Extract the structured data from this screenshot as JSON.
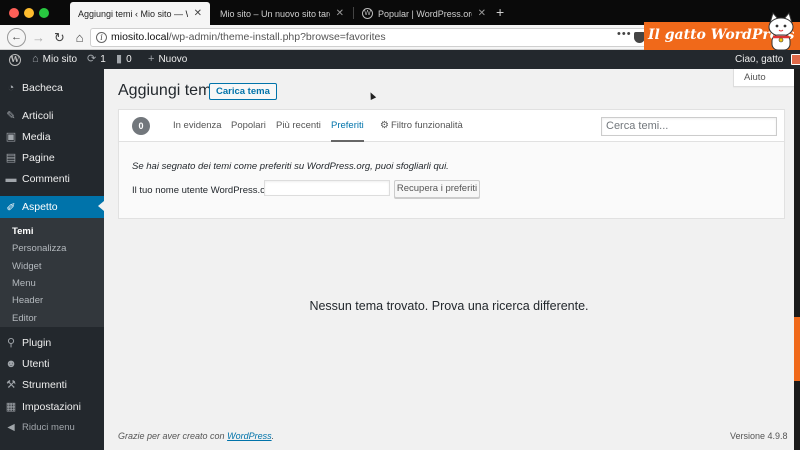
{
  "browser": {
    "tabs": [
      {
        "title": "Aggiungi temi ‹ Mio sito — WordPress",
        "active": true
      },
      {
        "title": "Mio sito – Un nuovo sito targato WordPress",
        "active": false
      },
      {
        "title": "Popular | WordPress.org",
        "active": false
      }
    ],
    "close_glyph": "✕",
    "new_tab_glyph": "+",
    "url_host": "miosito.local",
    "url_path": "/wp-admin/theme-install.php?browse=favorites",
    "overflow_glyph": "•••"
  },
  "brand": {
    "text": "Il gatto WordPress",
    "color": "#f0691a"
  },
  "admin_bar": {
    "site_name": "Mio sito",
    "updates_count": "1",
    "comments_count": "0",
    "new_label": "Nuovo",
    "greeting": "Ciao, gatto"
  },
  "sidebar": {
    "items": [
      {
        "label": "Bacheca",
        "icon": "dashboard-icon"
      },
      {
        "label": "Articoli",
        "icon": "pin-icon"
      },
      {
        "label": "Media",
        "icon": "media-icon"
      },
      {
        "label": "Pagine",
        "icon": "page-icon"
      },
      {
        "label": "Commenti",
        "icon": "comment-icon"
      },
      {
        "label": "Aspetto",
        "icon": "brush-icon",
        "current": true
      }
    ],
    "submenu": [
      "Temi",
      "Personalizza",
      "Widget",
      "Menu",
      "Header",
      "Editor"
    ],
    "items_after": [
      {
        "label": "Plugin",
        "icon": "plugin-icon"
      },
      {
        "label": "Utenti",
        "icon": "users-icon"
      },
      {
        "label": "Strumenti",
        "icon": "wrench-icon"
      },
      {
        "label": "Impostazioni",
        "icon": "settings-icon"
      }
    ],
    "collapse_label": "Riduci menu"
  },
  "main": {
    "help_label": "Aiuto",
    "title": "Aggiungi temi",
    "upload_button": "Carica tema",
    "theme_count": "0",
    "filter_tabs": [
      {
        "label": "In evidenza"
      },
      {
        "label": "Popolari"
      },
      {
        "label": "Più recenti"
      },
      {
        "label": "Preferiti",
        "current": true
      },
      {
        "label": "Filtro funzionalità"
      }
    ],
    "search_placeholder": "Cerca temi...",
    "favorites_description": "Se hai segnato dei temi come preferiti su WordPress.org, puoi sfogliarli qui.",
    "username_label": "Il tuo nome utente WordPress.org:",
    "username_value": "",
    "fetch_button": "Recupera i preferiti",
    "empty_message": "Nessun tema trovato. Prova una ricerca differente.",
    "footer_text": "Grazie per aver creato con",
    "footer_link": "WordPress",
    "version": "Versione 4.9.8"
  },
  "colors": {
    "wp_admin_dark": "#23282d",
    "wp_blue": "#0073aa",
    "content_bg": "#f1f1f1"
  }
}
